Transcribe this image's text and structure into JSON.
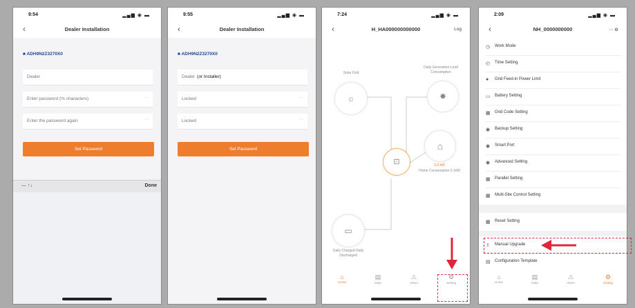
{
  "colors": {
    "accent": "#ee7d2e",
    "highlight": "#e0253a",
    "link": "#24468e"
  },
  "screens": [
    {
      "time": "9:54",
      "title": "Dealer Installation",
      "serial": "■ ADH9N2Z3270X0",
      "fields": [
        {
          "value": "Dealer",
          "suffix": ""
        },
        {
          "value": "Enter password (% characters)",
          "suffix": "···"
        },
        {
          "value": "Enter the password again",
          "suffix": "···"
        }
      ],
      "button": "Set Password",
      "keyboard": {
        "left": "—  ↑↓",
        "done": "Done"
      }
    },
    {
      "time": "9:55",
      "title": "Dealer Installation",
      "serial": "■ ADH9N2Z3270X0",
      "fields": [
        {
          "value": "Dealer",
          "suffix": "(or Installer)"
        },
        {
          "value": "Locked",
          "suffix": "···"
        },
        {
          "value": "Locked",
          "suffix": "···"
        }
      ],
      "button": "Set Password"
    },
    {
      "time": "7:24",
      "title": "H_HA000000000000",
      "nav_right": "Log",
      "nodes": {
        "solar": "Solar Grid",
        "load": "Daily Generation Load Consumption",
        "home": "Home Consumption 0.1kW",
        "home_value": "0.0 kW",
        "battery": "Daily Charged Daily Discharged"
      },
      "tabs": [
        "Home",
        "Data",
        "Alarm",
        "Setting"
      ]
    },
    {
      "time": "2:09",
      "title": "NH_0000000000",
      "menu": [
        "Work Mode",
        "Time Setting",
        "Grid Feed-in Power Limit",
        "Battery Setting",
        "Grid Code Setting",
        "Backup Setting",
        "Smart Port",
        "Advanced Setting",
        "Parallel Setting",
        "Multi-Site Control Setting",
        "Reset Setting",
        "Manual Upgrade",
        "Configuration Template"
      ],
      "tabs": [
        "Home",
        "Data",
        "Alarm",
        "Setting"
      ]
    }
  ]
}
